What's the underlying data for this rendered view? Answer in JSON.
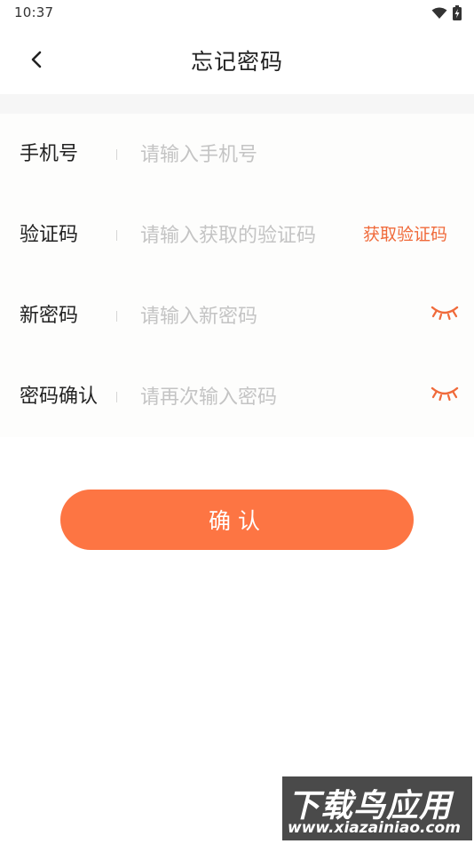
{
  "status_bar": {
    "time": "10:37",
    "icons": [
      "wifi-icon",
      "battery-charging-icon"
    ]
  },
  "header": {
    "title": "忘记密码",
    "back_icon": "chevron-left-icon"
  },
  "form": {
    "phone": {
      "label": "手机号",
      "placeholder": "请输入手机号",
      "value": ""
    },
    "code": {
      "label": "验证码",
      "placeholder": "请输入获取的验证码",
      "value": "",
      "get_code_label": "获取验证码"
    },
    "new_password": {
      "label": "新密码",
      "placeholder": "请输入新密码",
      "value": "",
      "toggle_icon": "eye-closed-icon"
    },
    "confirm_password": {
      "label": "密码确认",
      "placeholder": "请再次输入密码",
      "value": "",
      "toggle_icon": "eye-closed-icon"
    }
  },
  "confirm_button": {
    "label": "确认"
  },
  "watermark": {
    "title": "下载鸟应用",
    "url": "www.xiazainiao.com"
  },
  "colors": {
    "accent": "#fd7543",
    "link": "#f06a3a",
    "placeholder": "#c4c4c4"
  }
}
